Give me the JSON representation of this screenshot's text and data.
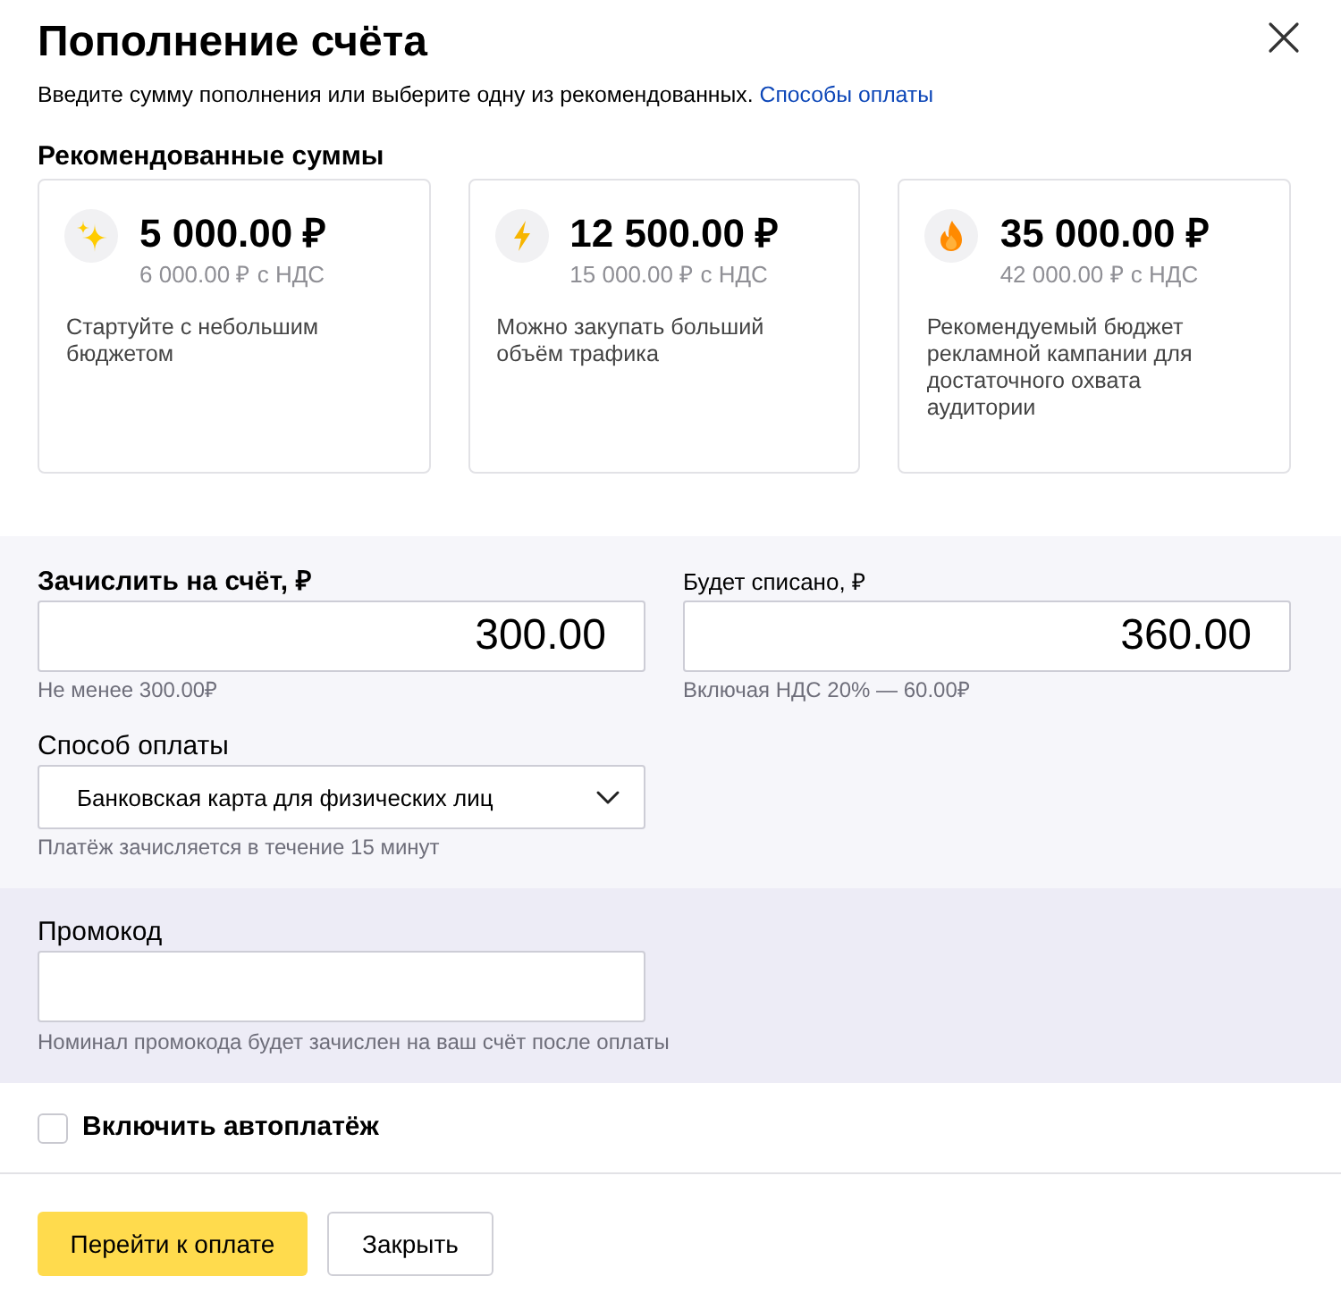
{
  "dialog": {
    "title": "Пополнение счёта",
    "subtitle": "Введите сумму пополнения или выберите одну из рекомендованных.",
    "subtitle_link": "Способы оплаты"
  },
  "recommended": {
    "heading": "Рекомендованные суммы",
    "cards": [
      {
        "kind": "sparkles",
        "amount": "5 000.00 ₽",
        "with_vat": "6 000.00 ₽ с НДС",
        "description": "Стартуйте с небольшим бюджетом",
        "selected": false
      },
      {
        "kind": "lightning",
        "amount": "12 500.00 ₽",
        "with_vat": "15 000.00 ₽ с НДС",
        "description": "Можно закупать больший объём трафика",
        "selected": false
      },
      {
        "kind": "fire",
        "amount": "35 000.00 ₽",
        "with_vat": "42 000.00 ₽ с НДС",
        "description": "Рекомендуемый бюджет рекламной кампании для достаточного охвата аудитории",
        "selected": false
      }
    ]
  },
  "credit": {
    "label": "Зачислить на счёт, ₽",
    "value": "300.00",
    "hint": "Не менее 300.00₽"
  },
  "charge": {
    "label": "Будет списано, ₽",
    "value": "360.00",
    "hint": "Включая НДС 20% — 60.00₽"
  },
  "payment_method": {
    "label": "Способ оплаты",
    "value": "Банковская карта для физических лиц",
    "hint": "Платёж зачисляется в течение 15 минут"
  },
  "promo_code": {
    "label": "Промокод",
    "hint": "Номинал промокода будет зачислен на ваш счёт после оплаты"
  },
  "autopay": {
    "label": "Включить автоплатёж",
    "checked": false
  },
  "buttons": [
    {
      "label": "Перейти к оплате",
      "kind": "primary"
    },
    {
      "label": "Закрыть",
      "kind": "secondary"
    }
  ]
}
